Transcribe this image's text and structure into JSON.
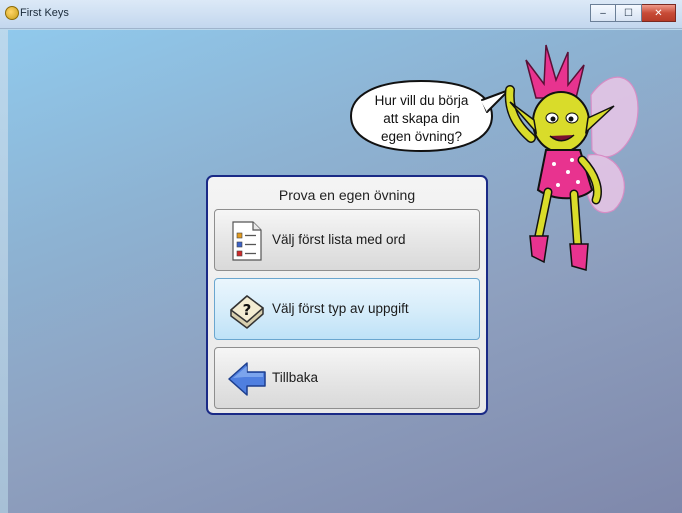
{
  "window": {
    "title": "First Keys",
    "controls": {
      "minimize": "–",
      "maximize": "☐",
      "close": "✕"
    },
    "colors": {
      "close": "#c84b37",
      "titlebar": "#c3d7ee"
    }
  },
  "speech": {
    "line1": "Hur vill du börja",
    "line2": "att skapa din",
    "line3": "egen övning?"
  },
  "mascot": {
    "icon": "fairy-mascot-icon"
  },
  "panel": {
    "title": "Prova en egen övning",
    "border_color": "#1a2a86",
    "options": [
      {
        "label": "Välj först lista med ord",
        "icon": "word-list-icon",
        "active": false
      },
      {
        "label": "Välj först typ av uppgift",
        "icon": "question-key-icon",
        "active": true
      },
      {
        "label": "Tillbaka",
        "icon": "back-arrow-icon",
        "active": false
      }
    ]
  }
}
